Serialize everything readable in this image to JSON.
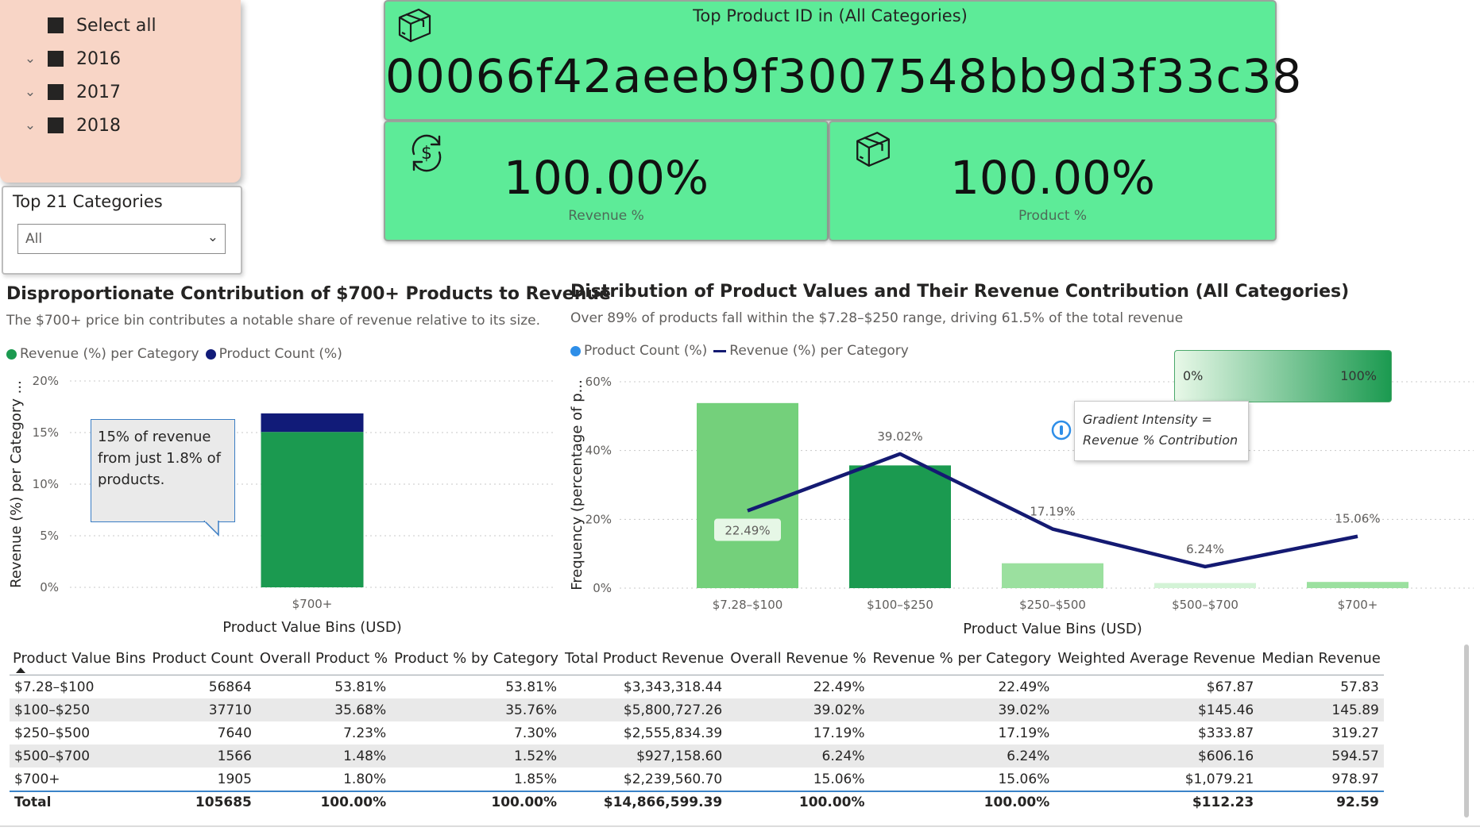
{
  "year_slicer": {
    "items": [
      {
        "label": "Select all",
        "chevron": false
      },
      {
        "label": "2016",
        "chevron": true
      },
      {
        "label": "2017",
        "chevron": true
      },
      {
        "label": "2018",
        "chevron": true
      }
    ]
  },
  "category_slicer": {
    "title": "Top 21 Categories",
    "value": "All"
  },
  "cards": {
    "top_product": {
      "title": "Top Product ID in (All Categories)",
      "value": "00066f42aeeb9f3007548bb9d3f33c38",
      "icon": "box-icon"
    },
    "revenue": {
      "value": "100.00%",
      "label": "Revenue %",
      "icon": "dollar-cycle-icon"
    },
    "product": {
      "value": "100.00%",
      "label": "Product %",
      "icon": "box-icon"
    }
  },
  "colors": {
    "card_green": "#5deb98",
    "revenue_green": "#1b9a50",
    "product_navy": "#111b78",
    "line_navy": "#141a72",
    "count_blue": "#2e8ee8"
  },
  "left_chart": {
    "title": "Disproportionate Contribution of $700+ Products to Revenue",
    "subtitle": "The $700+ price bin contributes a notable share of revenue relative to its size.",
    "legend": [
      "Revenue (%) per Category",
      "Product Count (%)"
    ],
    "annotation": "15% of revenue from just 1.8% of products.",
    "y_axis_label": "Revenue (%) per Category ...",
    "x_axis_label": "Product Value Bins (USD)",
    "y_ticks": [
      "0%",
      "5%",
      "10%",
      "15%",
      "20%"
    ]
  },
  "right_chart": {
    "title": "Distribution of Product Values and Their Revenue Contribution (All Categories)",
    "subtitle": "Over 89% of products fall within the $7.28–$250 range, driving 61.5% of the total revenue",
    "legend": [
      "Product Count (%)",
      "Revenue (%) per Category"
    ],
    "y_axis_label": "Frequency (percentage of p...",
    "x_axis_label": "Product Value Bins (USD)",
    "y_ticks": [
      "0%",
      "20%",
      "40%",
      "60%"
    ],
    "gradient_legend": {
      "low": "0%",
      "high": "100%"
    },
    "tooltip": {
      "line1": "Gradient Intensity =",
      "line2": "Revenue % Contribution"
    }
  },
  "chart_data": [
    {
      "type": "bar",
      "categories": [
        "$700+"
      ],
      "series": [
        {
          "name": "Revenue (%) per Category",
          "values": [
            15.06
          ]
        },
        {
          "name": "Product Count (%)",
          "values": [
            1.8
          ]
        }
      ],
      "title": "Disproportionate Contribution of $700+ Products to Revenue",
      "xlabel": "Product Value Bins (USD)",
      "ylabel": "Revenue (%) per Category ...",
      "ylim": [
        0,
        20
      ],
      "stacked": true,
      "grid": true,
      "legend": "top-left"
    },
    {
      "type": "bar",
      "categories": [
        "$7.28–$100",
        "$100–$250",
        "$250–$500",
        "$500–$700",
        "$700+"
      ],
      "series": [
        {
          "name": "Product Count (%)",
          "type": "bar",
          "values": [
            53.81,
            35.68,
            7.23,
            1.48,
            1.8
          ]
        },
        {
          "name": "Revenue (%) per Category",
          "type": "line",
          "values": [
            22.49,
            39.02,
            17.19,
            6.24,
            15.06
          ],
          "labels": [
            "22.49%",
            "39.02%",
            "17.19%",
            "6.24%",
            "15.06%"
          ]
        }
      ],
      "bar_colors": [
        "#74d07b",
        "#1b9a50",
        "#9be09f",
        "#d3f3d6",
        "#9be09f"
      ],
      "title": "Distribution of Product Values and Their Revenue Contribution (All Categories)",
      "xlabel": "Product Value Bins (USD)",
      "ylabel": "Frequency (percentage of p...",
      "ylim": [
        0,
        60
      ],
      "grid": true,
      "legend": "top-left"
    }
  ],
  "table": {
    "headers": [
      "Product Value Bins",
      "Product Count",
      "Overall Product %",
      "Product % by Category",
      "Total Product Revenue",
      "Overall Revenue %",
      "Revenue % per Category",
      "Weighted Average Revenue",
      "Median Revenue"
    ],
    "rows": [
      [
        "$7.28–$100",
        "56864",
        "53.81%",
        "53.81%",
        "$3,343,318.44",
        "22.49%",
        "22.49%",
        "$67.87",
        "57.83"
      ],
      [
        "$100–$250",
        "37710",
        "35.68%",
        "35.76%",
        "$5,800,727.26",
        "39.02%",
        "39.02%",
        "$145.46",
        "145.89"
      ],
      [
        "$250–$500",
        "7640",
        "7.23%",
        "7.30%",
        "$2,555,834.39",
        "17.19%",
        "17.19%",
        "$333.87",
        "319.27"
      ],
      [
        "$500–$700",
        "1566",
        "1.48%",
        "1.52%",
        "$927,158.60",
        "6.24%",
        "6.24%",
        "$606.16",
        "594.57"
      ],
      [
        "$700+",
        "1905",
        "1.80%",
        "1.85%",
        "$2,239,560.70",
        "15.06%",
        "15.06%",
        "$1,079.21",
        "978.97"
      ]
    ],
    "total": [
      "Total",
      "105685",
      "100.00%",
      "100.00%",
      "$14,866,599.39",
      "100.00%",
      "100.00%",
      "$112.23",
      "92.59"
    ]
  }
}
